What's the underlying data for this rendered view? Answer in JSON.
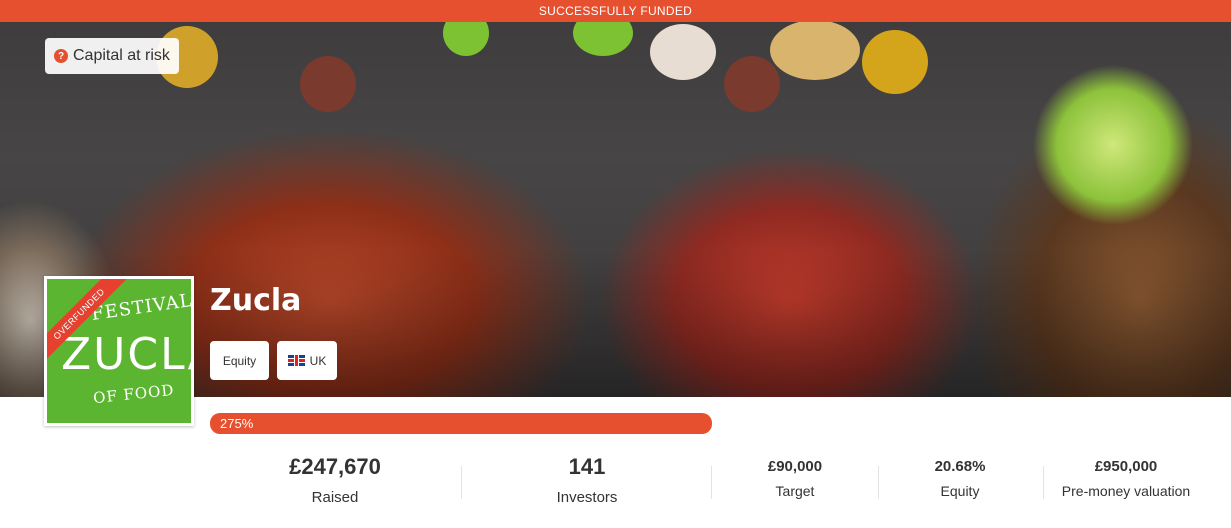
{
  "banner": {
    "status": "Successfully funded"
  },
  "risk": {
    "icon": "question-icon",
    "icon_glyph": "?",
    "label": "Capital at risk"
  },
  "company": {
    "name": "Zucla",
    "logo_ribbon": "Overfunded",
    "logo_top": "FESTIVAL",
    "logo_main": "ZUCLA",
    "logo_bottom": "OF FOOD",
    "tags": {
      "type": "Equity",
      "country": "UK",
      "country_flag": "uk-flag-icon"
    }
  },
  "progress": {
    "label": "275%",
    "percent": 275
  },
  "stats": {
    "raised": {
      "value": "£247,670",
      "label": "Raised"
    },
    "investors": {
      "value": "141",
      "label": "Investors"
    },
    "target": {
      "value": "£90,000",
      "label": "Target"
    },
    "equity": {
      "value": "20.68%",
      "label": "Equity"
    },
    "valuation": {
      "value": "£950,000",
      "label": "Pre-money valuation"
    }
  },
  "colors": {
    "accent": "#e6502f",
    "logo_green": "#5cb531"
  }
}
